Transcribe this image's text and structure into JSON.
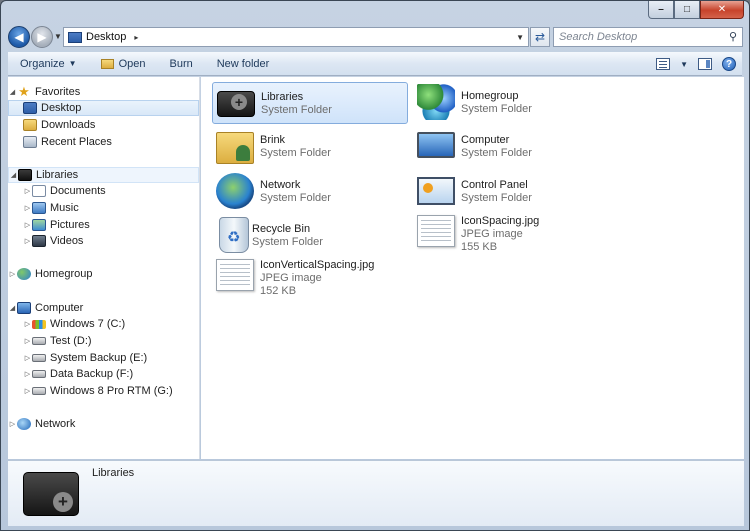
{
  "window": {
    "minimize": "–",
    "maximize": "□",
    "close": "✕"
  },
  "address": {
    "path": "Desktop",
    "separator": "▸",
    "search_placeholder": "Search Desktop"
  },
  "toolbar": {
    "organize": "Organize",
    "open": "Open",
    "burn": "Burn",
    "new_folder": "New folder"
  },
  "nav": {
    "favorites": {
      "label": "Favorites",
      "items": [
        "Desktop",
        "Downloads",
        "Recent Places"
      ]
    },
    "libraries": {
      "label": "Libraries",
      "items": [
        "Documents",
        "Music",
        "Pictures",
        "Videos"
      ]
    },
    "homegroup": "Homegroup",
    "computer": {
      "label": "Computer",
      "items": [
        "Windows 7 (C:)",
        "Test (D:)",
        "System Backup (E:)",
        "Data Backup (F:)",
        "Windows 8 Pro RTM (G:)"
      ]
    },
    "network": "Network"
  },
  "content": {
    "items": [
      {
        "name": "Libraries",
        "type": "System Folder",
        "size": ""
      },
      {
        "name": "Homegroup",
        "type": "System Folder",
        "size": ""
      },
      {
        "name": "Brink",
        "type": "System Folder",
        "size": ""
      },
      {
        "name": "Computer",
        "type": "System Folder",
        "size": ""
      },
      {
        "name": "Network",
        "type": "System Folder",
        "size": ""
      },
      {
        "name": "Control Panel",
        "type": "System Folder",
        "size": ""
      },
      {
        "name": "Recycle Bin",
        "type": "System Folder",
        "size": ""
      },
      {
        "name": "IconSpacing.jpg",
        "type": "JPEG image",
        "size": "155 KB"
      },
      {
        "name": "IconVerticalSpacing.jpg",
        "type": "JPEG image",
        "size": "152 KB"
      }
    ]
  },
  "details": {
    "name": "Libraries"
  },
  "colors": {
    "selection_bg": "#cfe3fa",
    "selection_border": "#84acdd",
    "toolbar_text": "#1e395b"
  }
}
